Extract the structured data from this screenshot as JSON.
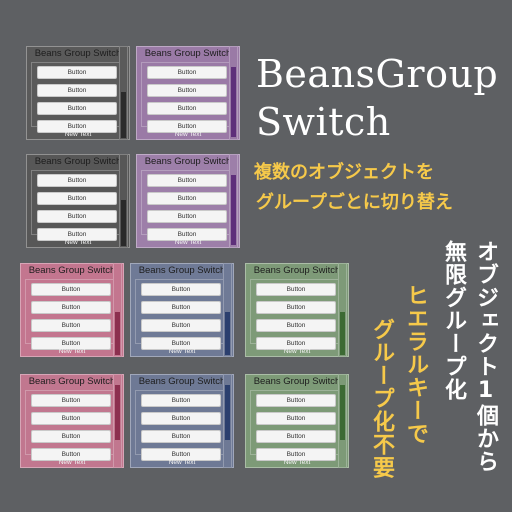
{
  "headline": {
    "line1": "BeansGroup",
    "line2": "Switch"
  },
  "tagline": {
    "line1": "複数のオブジェクトを",
    "line2": "グループごとに切り替え"
  },
  "vertical_text": {
    "col1": "オブジェクト1個から",
    "col2": "無限グループ化",
    "col3": "ヒエラルキーで",
    "col4": "グループ化不要"
  },
  "panel_template": {
    "title": "Beans Group Switch",
    "buttons": [
      "Button",
      "Button",
      "Button",
      "Button"
    ],
    "footer": "New Text"
  },
  "panels": [
    {
      "title": "Beans Group Switch",
      "b1": "Button",
      "b2": "Button",
      "b3": "Button",
      "b4": "Button",
      "footer": "New Text",
      "bg": "#5a5a5a",
      "bar": "#2b2b2b"
    },
    {
      "title": "Beans Group Switch",
      "b1": "Button",
      "b2": "Button",
      "b3": "Button",
      "b4": "Button",
      "footer": "New Text",
      "bg": "#9a7aa6",
      "bar": "#5e2f7a"
    },
    {
      "title": "Beans Group Switch",
      "b1": "Button",
      "b2": "Button",
      "b3": "Button",
      "b4": "Button",
      "footer": "New Text",
      "bg": "#575757",
      "bar": "#2a2a2a"
    },
    {
      "title": "Beans Group Switch",
      "b1": "Button",
      "b2": "Button",
      "b3": "Button",
      "b4": "Button",
      "footer": "New Text",
      "bg": "#9d7fa9",
      "bar": "#5e2f7a"
    },
    {
      "title": "Beans Group Switch",
      "b1": "Button",
      "b2": "Button",
      "b3": "Button",
      "b4": "Button",
      "footer": "New Text",
      "bg": "#c3768f",
      "bar": "#8c2f4f"
    },
    {
      "title": "Beans Group Switch",
      "b1": "Button",
      "b2": "Button",
      "b3": "Button",
      "b4": "Button",
      "footer": "New Text",
      "bg": "#6f7a96",
      "bar": "#2b3f6e"
    },
    {
      "title": "Beans Group Switch",
      "b1": "Button",
      "b2": "Button",
      "b3": "Button",
      "b4": "Button",
      "footer": "New Text",
      "bg": "#7e9a78",
      "bar": "#3c6a33"
    },
    {
      "title": "Beans Group Switch",
      "b1": "Button",
      "b2": "Button",
      "b3": "Button",
      "b4": "Button",
      "footer": "New Text",
      "bg": "#c1778f",
      "bar": "#8c2f4f"
    },
    {
      "title": "Beans Group Switch",
      "b1": "Button",
      "b2": "Button",
      "b3": "Button",
      "b4": "Button",
      "footer": "New Text",
      "bg": "#6e7995",
      "bar": "#2b3f6e"
    },
    {
      "title": "Beans Group Switch",
      "b1": "Button",
      "b2": "Button",
      "b3": "Button",
      "b4": "Button",
      "footer": "New Text",
      "bg": "#7d9a77",
      "bar": "#3c6a33"
    }
  ]
}
